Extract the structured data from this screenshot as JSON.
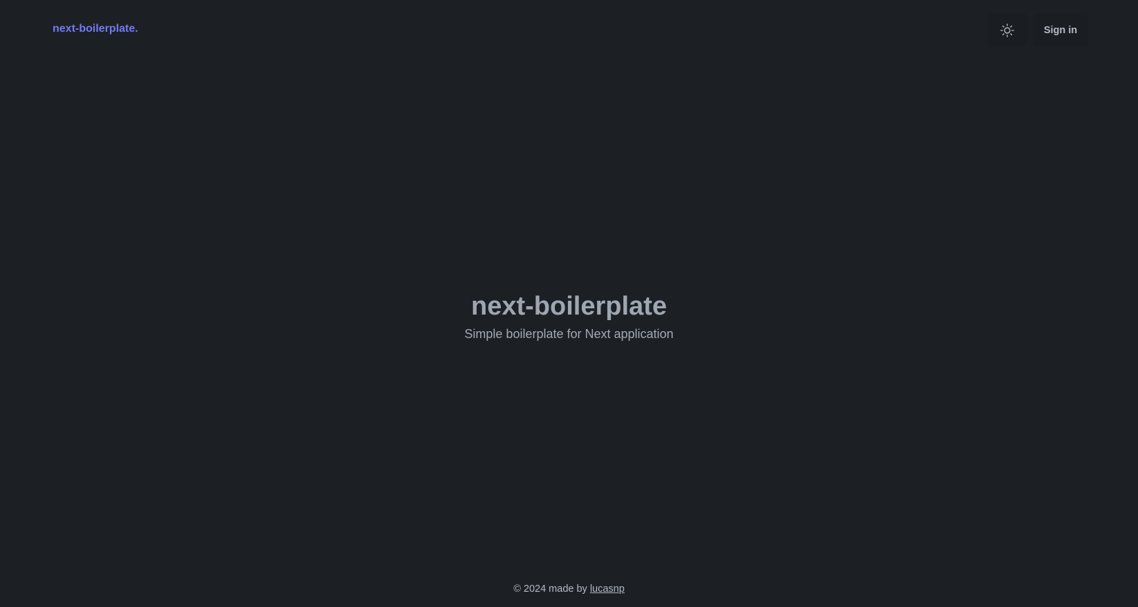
{
  "header": {
    "logo_text": "next-boilerplate.",
    "theme_toggle_icon": "sun-icon",
    "signin_label": "Sign in"
  },
  "hero": {
    "title": "next-boilerplate",
    "subtitle": "Simple boilerplate for Next application"
  },
  "footer": {
    "prefix": "© 2024 made by ",
    "author_link": "lucasnp"
  },
  "colors": {
    "background": "#1c2024",
    "accent": "#7479f2",
    "button_bg": "#1a1d21",
    "text_muted": "#b4b9c4",
    "title": "#9fa6b2"
  }
}
